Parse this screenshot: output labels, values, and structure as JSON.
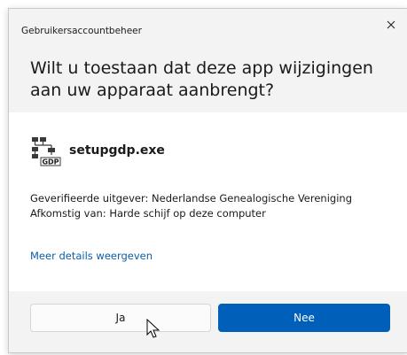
{
  "dialog": {
    "caption": "Gebruikersaccountbeheer",
    "question": "Wilt u toestaan dat deze app wijzigingen aan uw apparaat aanbrengt?",
    "close_icon": "close-icon"
  },
  "app": {
    "icon": "network-tree-icon",
    "name": "setupgdp.exe",
    "icon_label": "GDP"
  },
  "details": {
    "publisher": "Geverifieerde uitgever: Nederlandse Genealogische Vereniging",
    "origin": "Afkomstig van: Harde schijf op deze computer"
  },
  "link": {
    "more_details": "Meer details weergeven"
  },
  "buttons": {
    "yes": "Ja",
    "no": "Nee"
  },
  "colors": {
    "accent": "#005fb8",
    "link": "#0a5ea8",
    "header_bg": "#f3f3f3"
  }
}
